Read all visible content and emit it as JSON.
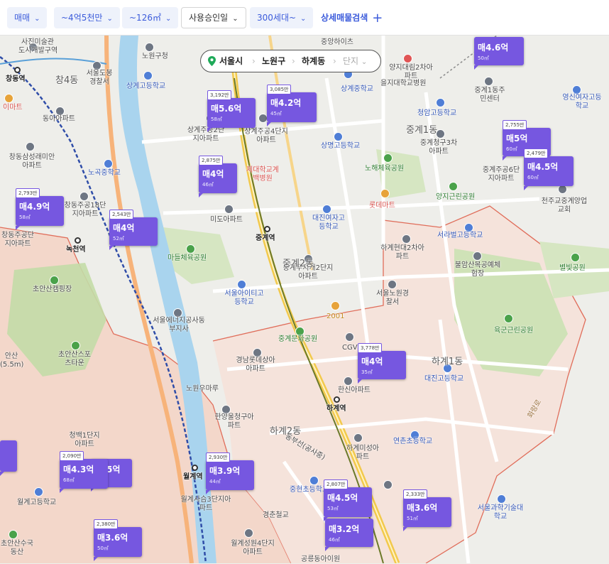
{
  "filters": {
    "deal_type": "매매",
    "price": "~4억5천만",
    "area": "~126㎡",
    "approval_date": "사용승인일",
    "households": "300세대~",
    "advanced_search": "상세매물검색"
  },
  "breadcrumb": {
    "city": "서울시",
    "district": "노원구",
    "dong": "하계동",
    "complex": "단지"
  },
  "colors": {
    "marker": "#7657e0",
    "accent": "#3b5bdb",
    "boundary": "#e06d5a",
    "subway_line7": "#6c7a2a",
    "subway_line1": "#2f4da8"
  },
  "markers": [
    {
      "count": "3,192만",
      "price": "매5.6억",
      "area": "58㎡"
    },
    {
      "count": "3,085만",
      "price": "매4.2억",
      "area": "45㎡"
    },
    {
      "count": "",
      "price": "매4.6억",
      "area": "50㎡"
    },
    {
      "count": "2,755만",
      "price": "매5억",
      "area": "60㎡"
    },
    {
      "count": "2,479만",
      "price": "매4.5억",
      "area": "60㎡"
    },
    {
      "count": "2,875만",
      "price": "매4억",
      "area": "46㎡"
    },
    {
      "count": "2,793만",
      "price": "매4.9억",
      "area": "58㎡"
    },
    {
      "count": "2,543만",
      "price": "매4억",
      "area": "52㎡"
    },
    {
      "count": "3,778만",
      "price": "매4억",
      "area": "35㎡"
    },
    {
      "count": "",
      "price": "5억",
      "area": ""
    },
    {
      "count": "2,090만",
      "price": "매4.3억",
      "area": "68㎡"
    },
    {
      "count": "2,930만",
      "price": "매3.9억",
      "area": "44㎡"
    },
    {
      "count": "2,807만",
      "price": "매4.5억",
      "area": "53㎡"
    },
    {
      "count": "",
      "price": "매3.2억",
      "area": "46㎡"
    },
    {
      "count": "2,333만",
      "price": "매3.6억",
      "area": "51㎡"
    },
    {
      "count": "2,380만",
      "price": "매3.6억",
      "area": "50㎡"
    }
  ],
  "stations": {
    "changdong": "창동역",
    "nokcheon": "녹천역",
    "junggye": "중계역",
    "hagye": "하계역",
    "wolgye": "월계역"
  },
  "labels": {
    "l1": "사진미술관",
    "l2": "도시개발구역",
    "l3": "노원구청",
    "l4": "서울도봉경찰서",
    "l5": "창4동",
    "l6": "이마트",
    "l7": "동아아파트",
    "l8": "창동삼성래미안아파트",
    "l9": "노곡중학교",
    "l10": "창동주공18단지아파트",
    "l11": "창동주공단지아파트",
    "l12": "초안산캠핑장",
    "l13": "초안산스포츠타운",
    "l14": "안산(5.5m)",
    "l15": "청백1단지아파트",
    "l16": "월계고등학교",
    "l17": "초안산수국동산",
    "l18": "상계고등학교",
    "l19": "상계주공2단지아파트",
    "l20": "상계주공4단지아파트",
    "l21": "을지대학교병원",
    "l22": "상계중학교",
    "l23": "상명고등학교",
    "l24": "중앙하이츠",
    "l25": "양지대림2차아파트",
    "l26": "중계1동주민센터",
    "l27": "청암고등학교",
    "l28": "중계1동",
    "l29": "중계청구3차아파트",
    "l30": "노해체육공원",
    "l31": "영신여자고등학교",
    "l32": "중계주공6단지아파트",
    "l33": "천주교중계양업교회",
    "l34": "양지근린공원",
    "l35": "롯데마트",
    "l36": "서라벌고등학교",
    "l37": "미도아파트",
    "l38": "대진여자고등학교",
    "l39": "마들체육공원",
    "l40": "하계현대2차아파트",
    "l41": "불암산목공예체험장",
    "l42": "별빛공원",
    "l43": "중계무지개2단지아파트",
    "l44": "서울아이티고등학교",
    "l45": "서울노원경찰서",
    "l46": "2001",
    "l47": "서울에너지공사동부지사",
    "l48": "중계문화공원",
    "l49": "CGV",
    "l50": "육군근린공원",
    "l51": "경남롯데상아아파트",
    "l52": "하계1동",
    "l53": "대진고등학교",
    "l54": "노원우마루",
    "l55": "한신아파트",
    "l56": "한양울청구아파트",
    "l57": "하계2동",
    "l58": "연촌초등학교",
    "l59": "하계미성아파트",
    "l60": "월계사슴3단지아파트",
    "l61": "중현초등학교",
    "l62": "경춘철교",
    "l63": "서울과학기술대학교",
    "l64": "월계성원4단지아파트",
    "l65": "공릉동아이원",
    "l66": "화랑로",
    "l67": "동부선(공사중)",
    "l68": "제대학교계백병원",
    "l69": "중계2동"
  }
}
